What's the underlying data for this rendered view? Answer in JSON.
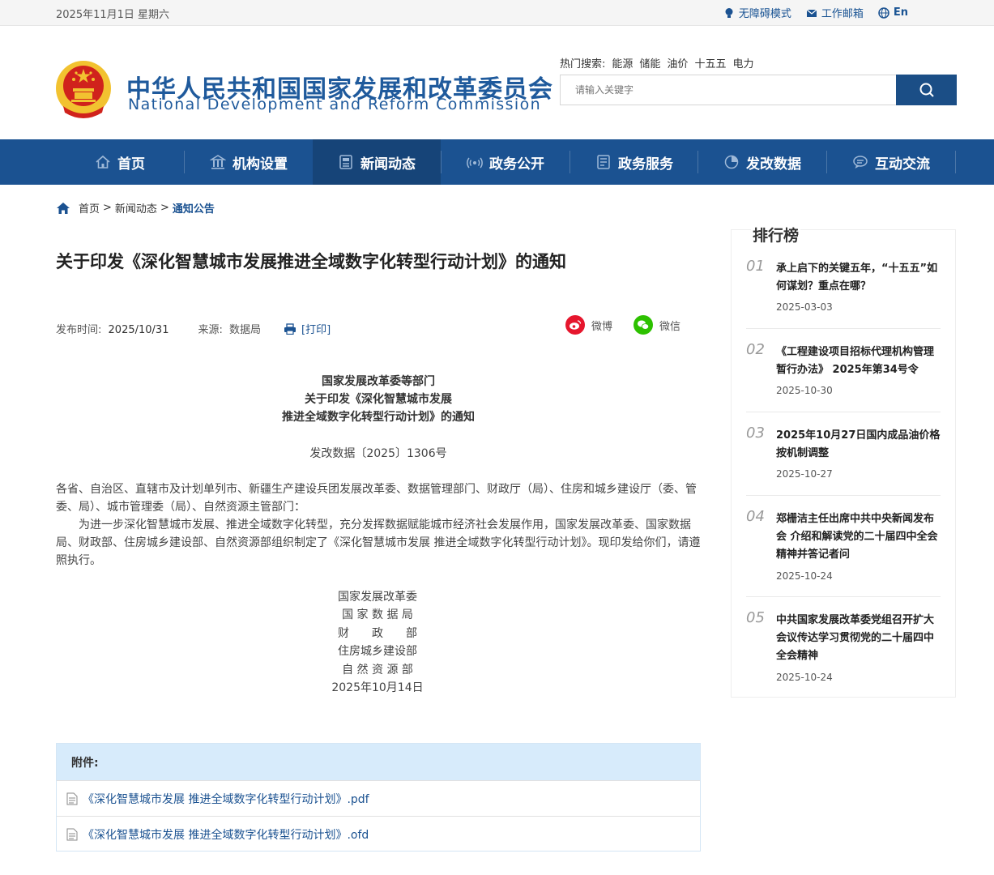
{
  "topbar": {
    "date": "2025年11月1日 星期六",
    "accessibility": "无障碍模式",
    "mail": "工作邮箱",
    "lang": "En"
  },
  "header": {
    "title_cn": "中华人民共和国国家发展和改革委员会",
    "title_en": "National Development and Reform Commission",
    "hot_label": "热门搜索:",
    "hot_terms": [
      "能源",
      "储能",
      "油价",
      "十五五",
      "电力"
    ],
    "search_placeholder": "请输入关键字"
  },
  "nav": [
    {
      "label": "首页",
      "icon": "home-icon"
    },
    {
      "label": "机构设置",
      "icon": "building-icon"
    },
    {
      "label": "新闻动态",
      "icon": "news-icon"
    },
    {
      "label": "政务公开",
      "icon": "signal-icon"
    },
    {
      "label": "政务服务",
      "icon": "document-icon"
    },
    {
      "label": "发改数据",
      "icon": "pie-chart-icon"
    },
    {
      "label": "互动交流",
      "icon": "chat-icon"
    }
  ],
  "breadcrumb": {
    "home": "首页",
    "sep": ">",
    "level1": "新闻动态",
    "current": "通知公告"
  },
  "article": {
    "title": "关于印发《深化智慧城市发展推进全域数字化转型行动计划》的通知",
    "pub_label": "发布时间:",
    "pub_date": "2025/10/31",
    "src_label": "来源:",
    "source": "数据局",
    "print": "[打印]",
    "share_weibo": "微博",
    "share_wechat": "微信",
    "head_line1": "国家发展改革委等部门",
    "head_line2": "关于印发《深化智慧城市发展",
    "head_line3": "推进全域数字化转型行动计划》的通知",
    "doc_no": "发改数据〔2025〕1306号",
    "para1": "各省、自治区、直辖市及计划单列市、新疆生产建设兵团发展改革委、数据管理部门、财政厅（局）、住房和城乡建设厅（委、管委、局）、城市管理委（局）、自然资源主管部门：",
    "para2": "为进一步深化智慧城市发展、推进全域数字化转型，充分发挥数据赋能城市经济社会发展作用，国家发展改革委、国家数据局、财政部、住房城乡建设部、自然资源部组织制定了《深化智慧城市发展 推进全域数字化转型行动计划》。现印发给你们，请遵照执行。",
    "signers": [
      "国家发展改革委",
      "国 家 数 据 局",
      "财　　政　　部",
      "住房城乡建设部",
      "自 然 资 源 部"
    ],
    "sign_date": "2025年10月14日"
  },
  "attachments": {
    "label": "附件:",
    "files": [
      "《深化智慧城市发展 推进全域数字化转型行动计划》.pdf",
      "《深化智慧城市发展 推进全域数字化转型行动计划》.ofd"
    ]
  },
  "ranking": {
    "title": "排行榜",
    "items": [
      {
        "num": "01",
        "title": "承上启下的关键五年，“十五五”如何谋划？重点在哪？",
        "date": "2025-03-03"
      },
      {
        "num": "02",
        "title": "《工程建设项目招标代理机构管理暂行办法》 2025年第34号令",
        "date": "2025-10-30"
      },
      {
        "num": "03",
        "title": "2025年10月27日国内成品油价格按机制调整",
        "date": "2025-10-27"
      },
      {
        "num": "04",
        "title": "郑栅洁主任出席中共中央新闻发布会 介绍和解读党的二十届四中全会精神并答记者问",
        "date": "2025-10-24"
      },
      {
        "num": "05",
        "title": "中共国家发展改革委党组召开扩大会议传达学习贯彻党的二十届四中全会精神",
        "date": "2025-10-24"
      }
    ]
  },
  "colors": {
    "brand_blue": "#1b5291",
    "nav_active": "#164478",
    "emblem_red": "#d0221c",
    "emblem_gold": "#f2c230",
    "weibo_red": "#e6162d",
    "wechat_green": "#2dc100",
    "attach_head": "#d7ebfb"
  }
}
